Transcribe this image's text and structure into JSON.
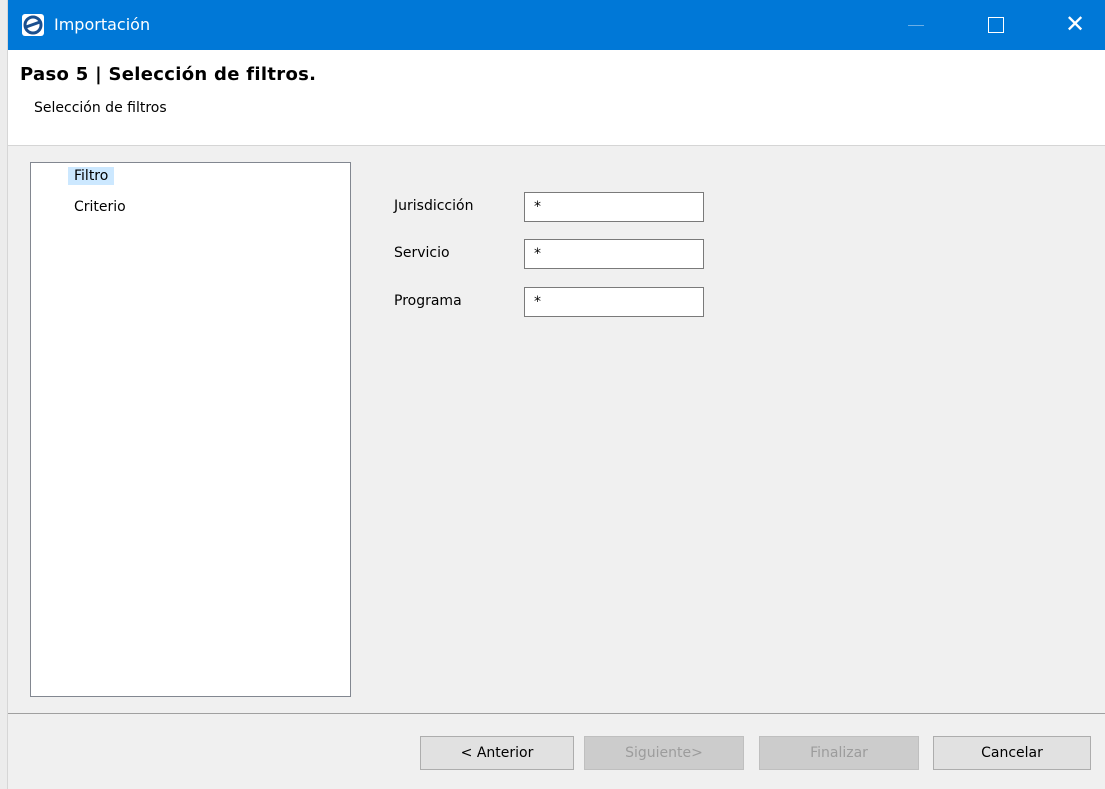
{
  "window": {
    "title": "Importación",
    "icon": "app-logo-icon"
  },
  "title_buttons": {
    "close_glyph": "✕"
  },
  "header": {
    "step_title": "Paso 5 | Selección de filtros.",
    "subtitle": "Selección de filtros"
  },
  "tree": {
    "items": [
      {
        "label": "Filtro",
        "selected": true
      },
      {
        "label": "Criterio",
        "selected": false
      }
    ]
  },
  "fields": [
    {
      "label": "Jurisdicción",
      "value": "*"
    },
    {
      "label": "Servicio",
      "value": "*"
    },
    {
      "label": "Programa",
      "value": "*"
    }
  ],
  "buttons": {
    "previous": {
      "label": "< Anterior",
      "enabled": true
    },
    "next": {
      "label": "Siguiente>",
      "enabled": false
    },
    "finish": {
      "label": "Finalizar",
      "enabled": false
    },
    "cancel": {
      "label": "Cancelar",
      "enabled": true
    }
  },
  "colors": {
    "titlebar": "#0078d7",
    "selection": "#cce8ff"
  }
}
